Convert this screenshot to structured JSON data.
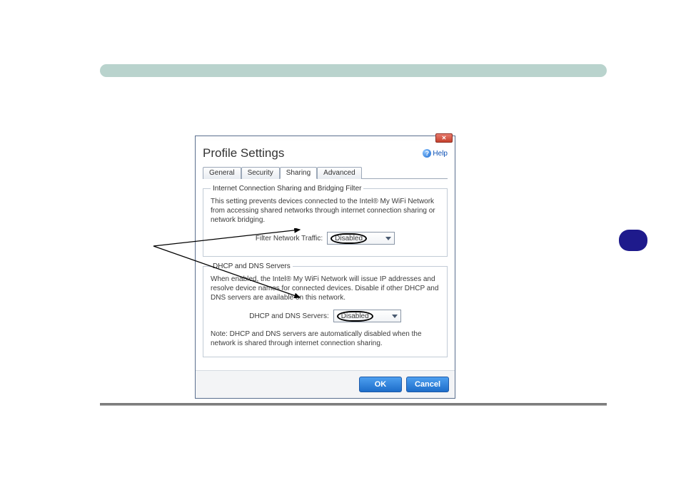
{
  "dialog": {
    "title": "Profile Settings",
    "help_label": "Help",
    "close_glyph": "✕",
    "tabs": [
      {
        "label": "General"
      },
      {
        "label": "Security"
      },
      {
        "label": "Sharing"
      },
      {
        "label": "Advanced"
      }
    ],
    "active_tab_index": 2,
    "group1": {
      "legend": "Internet Connection Sharing and Bridging Filter",
      "desc": "This setting prevents devices connected to the Intel® My WiFi Network from accessing shared networks through internet connection sharing or network bridging.",
      "field_label": "Filter Network Traffic:",
      "value": "Disabled"
    },
    "group2": {
      "legend": "DHCP and DNS Servers",
      "desc": "When enabled, the Intel® My WiFi Network will issue IP addresses and resolve device names for connected devices.  Disable if other DHCP and DNS servers are available on this network.",
      "field_label": "DHCP and DNS Servers:",
      "value": "Disabled",
      "note": "Note: DHCP and DNS servers are automatically disabled when the network is shared through internet connection sharing."
    },
    "buttons": {
      "ok": "OK",
      "cancel": "Cancel"
    }
  }
}
